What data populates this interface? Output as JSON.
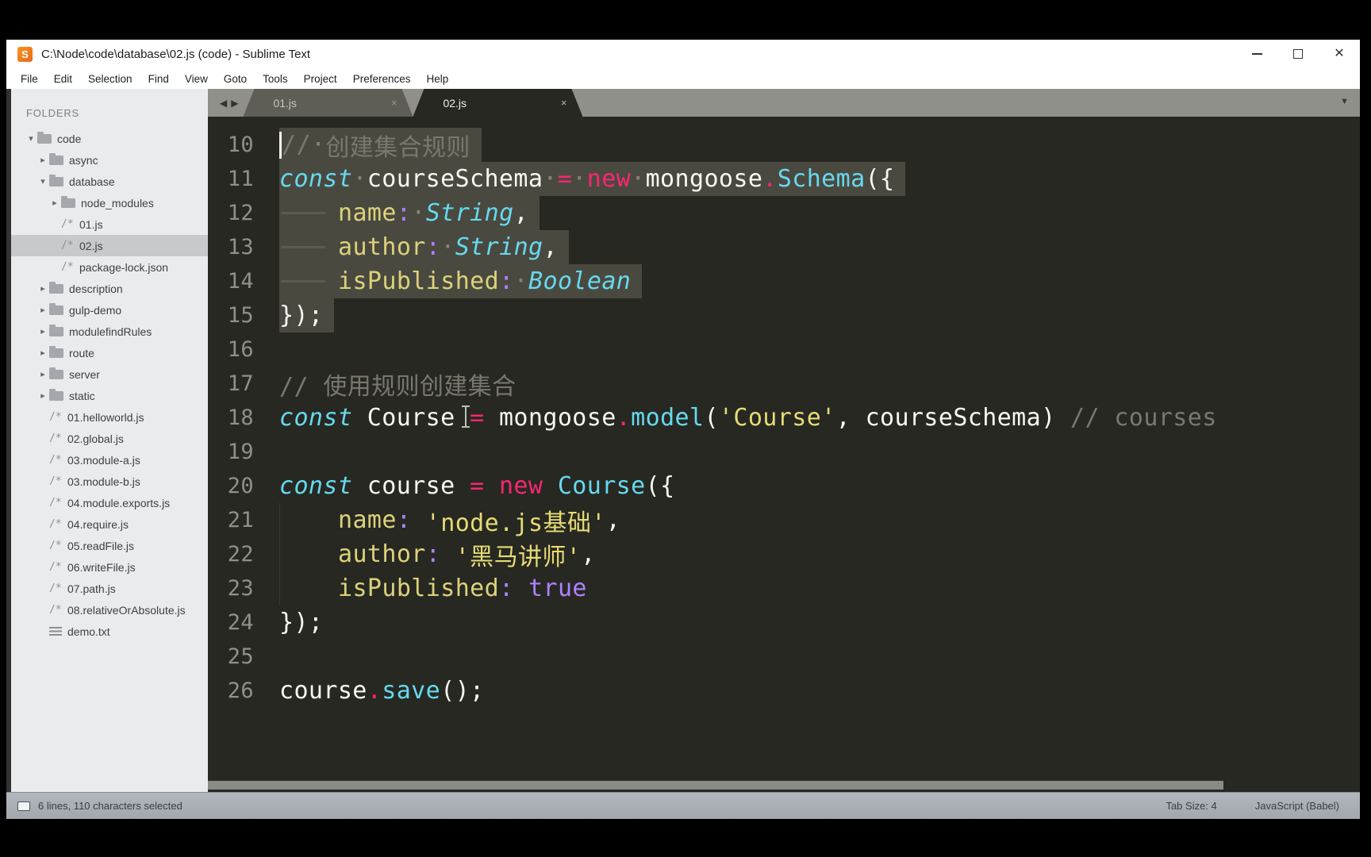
{
  "window": {
    "title": "C:\\Node\\code\\database\\02.js (code) - Sublime Text",
    "logo_letter": "S",
    "menu": [
      "File",
      "Edit",
      "Selection",
      "Find",
      "View",
      "Goto",
      "Tools",
      "Project",
      "Preferences",
      "Help"
    ]
  },
  "icons": {
    "minimize": "minimize-bar",
    "maximize": "maximize-box",
    "close": "✕",
    "tab_close": "×",
    "dropdown": "▼",
    "scroll_left": "◀",
    "scroll_right": "▶",
    "expanded": "▾",
    "collapsed": "▸",
    "file_js": "/*"
  },
  "sidebar": {
    "heading": "FOLDERS",
    "items": [
      {
        "label": "code",
        "type": "folder",
        "level": 0,
        "expanded": true
      },
      {
        "label": "async",
        "type": "folder",
        "level": 1,
        "expanded": false
      },
      {
        "label": "database",
        "type": "folder",
        "level": 1,
        "expanded": true
      },
      {
        "label": "node_modules",
        "type": "folder",
        "level": 2,
        "expanded": false
      },
      {
        "label": "01.js",
        "type": "file",
        "level": 2
      },
      {
        "label": "02.js",
        "type": "file",
        "level": 2,
        "selected": true
      },
      {
        "label": "package-lock.json",
        "type": "file",
        "level": 2
      },
      {
        "label": "description",
        "type": "folder",
        "level": 1,
        "expanded": false
      },
      {
        "label": "gulp-demo",
        "type": "folder",
        "level": 1,
        "expanded": false
      },
      {
        "label": "modulefindRules",
        "type": "folder",
        "level": 1,
        "expanded": false
      },
      {
        "label": "route",
        "type": "folder",
        "level": 1,
        "expanded": false
      },
      {
        "label": "server",
        "type": "folder",
        "level": 1,
        "expanded": false
      },
      {
        "label": "static",
        "type": "folder",
        "level": 1,
        "expanded": false
      },
      {
        "label": "01.helloworld.js",
        "type": "file",
        "level": 1
      },
      {
        "label": "02.global.js",
        "type": "file",
        "level": 1
      },
      {
        "label": "03.module-a.js",
        "type": "file",
        "level": 1
      },
      {
        "label": "03.module-b.js",
        "type": "file",
        "level": 1
      },
      {
        "label": "04.module.exports.js",
        "type": "file",
        "level": 1
      },
      {
        "label": "04.require.js",
        "type": "file",
        "level": 1
      },
      {
        "label": "05.readFile.js",
        "type": "file",
        "level": 1
      },
      {
        "label": "06.writeFile.js",
        "type": "file",
        "level": 1
      },
      {
        "label": "07.path.js",
        "type": "file",
        "level": 1
      },
      {
        "label": "08.relativeOrAbsolute.js",
        "type": "file",
        "level": 1
      },
      {
        "label": "demo.txt",
        "type": "file-text",
        "level": 1
      }
    ]
  },
  "tabs": [
    {
      "label": "01.js",
      "active": false
    },
    {
      "label": "02.js",
      "active": true
    }
  ],
  "editor": {
    "lines": [
      {
        "n": 10,
        "sel": true,
        "caret": true,
        "tokens": [
          [
            "//",
            "c"
          ],
          [
            " ",
            "sp"
          ],
          [
            "创建集合规则",
            "c"
          ]
        ]
      },
      {
        "n": 11,
        "sel": true,
        "tokens": [
          [
            "const",
            "s"
          ],
          [
            " ",
            "sp"
          ],
          [
            "courseSchema",
            "w"
          ],
          [
            " ",
            "sp"
          ],
          [
            "=",
            "k"
          ],
          [
            " ",
            "sp"
          ],
          [
            "new",
            "k"
          ],
          [
            " ",
            "sp"
          ],
          [
            "mongoose",
            "w"
          ],
          [
            ".",
            "k"
          ],
          [
            "Schema",
            "f"
          ],
          [
            "({",
            "w"
          ]
        ]
      },
      {
        "n": 12,
        "sel": true,
        "tokens": [
          [
            "\t",
            "tab"
          ],
          [
            "name",
            "y"
          ],
          [
            ":",
            "p"
          ],
          [
            " ",
            "sp"
          ],
          [
            "String",
            "t"
          ],
          [
            ",",
            "w"
          ]
        ]
      },
      {
        "n": 13,
        "sel": true,
        "tokens": [
          [
            "\t",
            "tab"
          ],
          [
            "author",
            "y"
          ],
          [
            ":",
            "p"
          ],
          [
            " ",
            "sp"
          ],
          [
            "String",
            "t"
          ],
          [
            ",",
            "w"
          ]
        ]
      },
      {
        "n": 14,
        "sel": true,
        "tokens": [
          [
            "\t",
            "tab"
          ],
          [
            "isPublished",
            "y"
          ],
          [
            ":",
            "p"
          ],
          [
            " ",
            "sp"
          ],
          [
            "Boolean",
            "t"
          ]
        ]
      },
      {
        "n": 15,
        "sel": true,
        "tokens": [
          [
            "});",
            "w"
          ]
        ]
      },
      {
        "n": 16,
        "tokens": []
      },
      {
        "n": 17,
        "tokens": [
          [
            "// 使用规则创建集合",
            "c"
          ]
        ]
      },
      {
        "n": 18,
        "tokens": [
          [
            "const",
            "s"
          ],
          [
            " ",
            "w"
          ],
          [
            "Course",
            "w"
          ],
          [
            " ",
            "w"
          ],
          [
            "=",
            "k"
          ],
          [
            " ",
            "w"
          ],
          [
            "mongoose",
            "w"
          ],
          [
            ".",
            "k"
          ],
          [
            "model",
            "f"
          ],
          [
            "(",
            "w"
          ],
          [
            "'Course'",
            "str"
          ],
          [
            ", ",
            "w"
          ],
          [
            "courseSchema",
            "w"
          ],
          [
            ")",
            "w"
          ],
          [
            " ",
            "w"
          ],
          [
            "// courses",
            "c"
          ]
        ]
      },
      {
        "n": 19,
        "tokens": []
      },
      {
        "n": 20,
        "tokens": [
          [
            "const",
            "s"
          ],
          [
            " ",
            "w"
          ],
          [
            "course",
            "w"
          ],
          [
            " ",
            "w"
          ],
          [
            "=",
            "k"
          ],
          [
            " ",
            "w"
          ],
          [
            "new",
            "k"
          ],
          [
            " ",
            "w"
          ],
          [
            "Course",
            "f"
          ],
          [
            "({",
            "w"
          ]
        ]
      },
      {
        "n": 21,
        "guide": true,
        "tokens": [
          [
            "\t",
            "tab"
          ],
          [
            "name",
            "y"
          ],
          [
            ":",
            "p"
          ],
          [
            " ",
            "w"
          ],
          [
            "'node.js基础'",
            "str"
          ],
          [
            ",",
            "w"
          ]
        ]
      },
      {
        "n": 22,
        "guide": true,
        "tokens": [
          [
            "\t",
            "tab"
          ],
          [
            "author",
            "y"
          ],
          [
            ":",
            "p"
          ],
          [
            " ",
            "w"
          ],
          [
            "'黑马讲师'",
            "str"
          ],
          [
            ",",
            "w"
          ]
        ]
      },
      {
        "n": 23,
        "guide": true,
        "tokens": [
          [
            "\t",
            "tab"
          ],
          [
            "isPublished",
            "y"
          ],
          [
            ":",
            "p"
          ],
          [
            " ",
            "w"
          ],
          [
            "true",
            "v"
          ]
        ]
      },
      {
        "n": 24,
        "tokens": [
          [
            "});",
            "w"
          ]
        ]
      },
      {
        "n": 25,
        "tokens": []
      },
      {
        "n": 26,
        "tokens": [
          [
            "course",
            "w"
          ],
          [
            ".",
            "k"
          ],
          [
            "save",
            "f"
          ],
          [
            "();",
            "w"
          ]
        ]
      }
    ]
  },
  "status": {
    "selection_info": "6 lines, 110 characters selected",
    "tab_size": "Tab Size: 4",
    "syntax": "JavaScript (Babel)"
  },
  "colors": {
    "editor_bg": "#272822",
    "selection_bg": "#4a4940",
    "keyword_pink": "#f92672",
    "type_cyan": "#66d9ef",
    "string_yellow": "#e6db74",
    "constant_purple": "#ae81ff",
    "comment_gray": "#7a786e",
    "foreground": "#f8f8f2",
    "sidebar_bg": "#e9ebed",
    "tabbar_bg": "#8f9089",
    "statusbar_bg": "#aab0b6",
    "logo_orange": "#ef7b24"
  }
}
